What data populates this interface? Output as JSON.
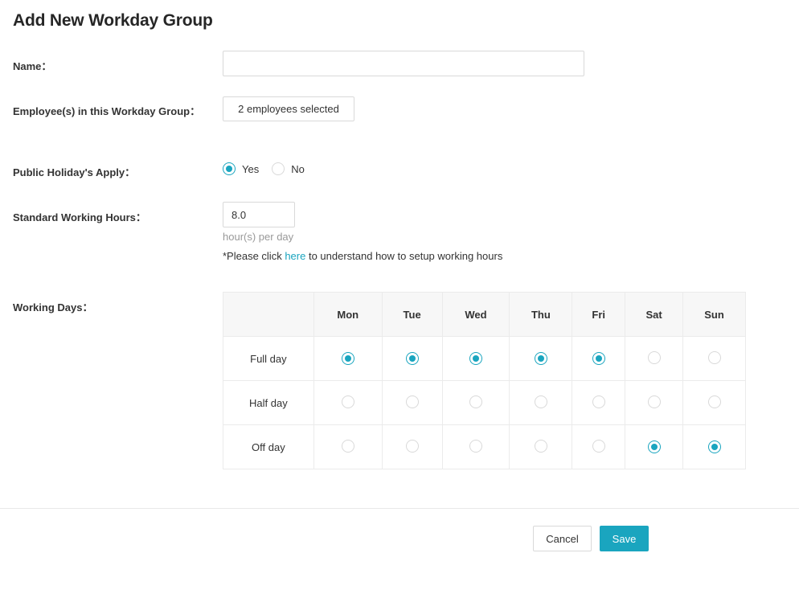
{
  "page": {
    "title": "Add New Workday Group"
  },
  "form": {
    "name": {
      "label": "Name：",
      "value": "",
      "placeholder": ""
    },
    "employees": {
      "label": "Employee(s) in this Workday Group：",
      "button_label": "2 employees selected"
    },
    "public_holiday": {
      "label": "Public Holiday's Apply：",
      "options": [
        {
          "label": "Yes",
          "selected": true
        },
        {
          "label": "No",
          "selected": false
        }
      ]
    },
    "standard_hours": {
      "label": "Standard Working Hours：",
      "value": "8.0",
      "hint": "hour(s) per day",
      "note_prefix": "*Please click ",
      "note_link": "here",
      "note_suffix": " to understand how to setup working hours"
    },
    "working_days": {
      "label": "Working Days：",
      "days": [
        "Mon",
        "Tue",
        "Wed",
        "Thu",
        "Fri",
        "Sat",
        "Sun"
      ],
      "rows": [
        {
          "label": "Full day",
          "selected": [
            true,
            true,
            true,
            true,
            true,
            false,
            false
          ]
        },
        {
          "label": "Half day",
          "selected": [
            false,
            false,
            false,
            false,
            false,
            false,
            false
          ]
        },
        {
          "label": "Off day",
          "selected": [
            false,
            false,
            false,
            false,
            false,
            true,
            true
          ]
        }
      ]
    }
  },
  "footer": {
    "cancel_label": "Cancel",
    "save_label": "Save"
  },
  "colors": {
    "accent": "#1aa5bf",
    "border": "#d9d9d9",
    "header_bg": "#f7f7f7"
  }
}
